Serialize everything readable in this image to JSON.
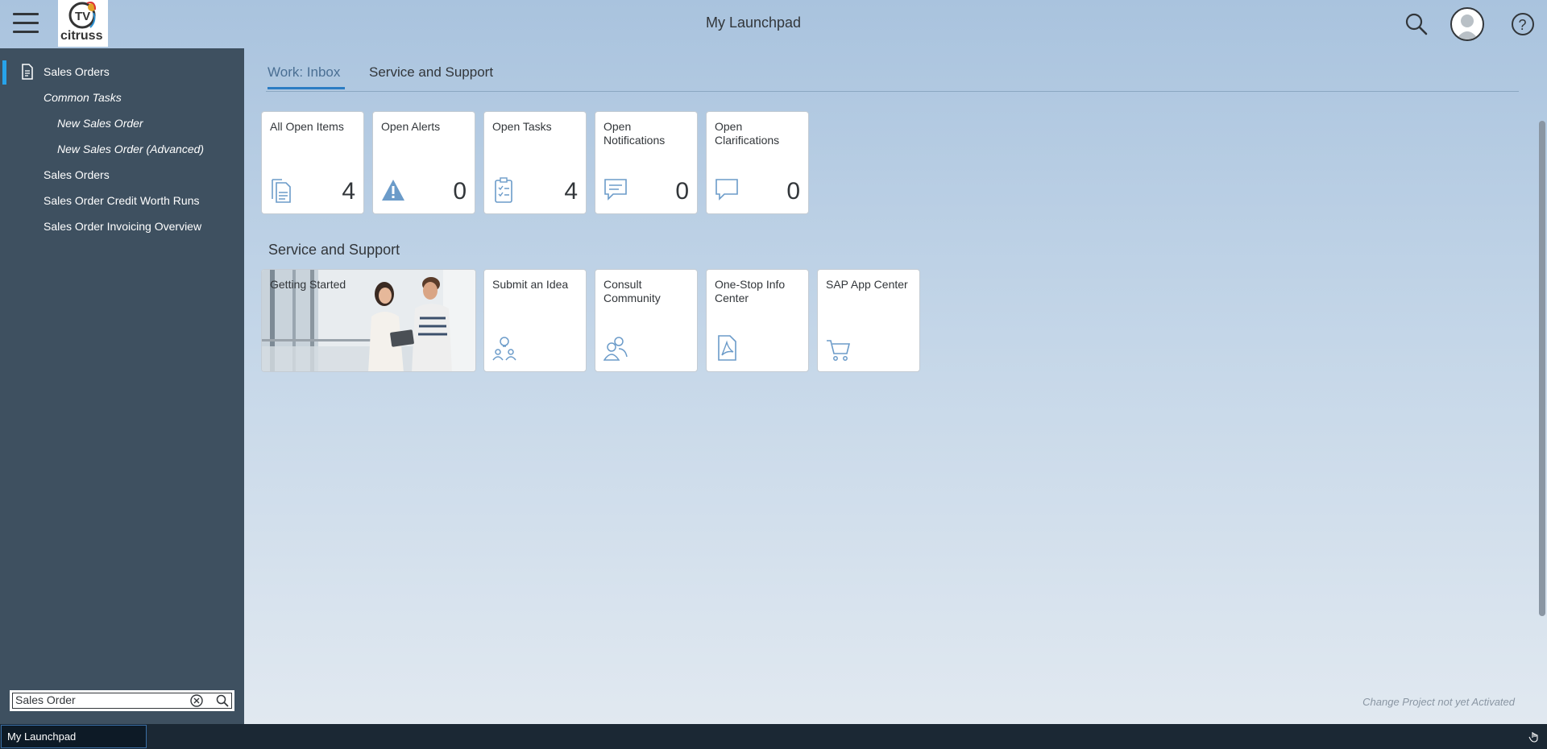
{
  "header": {
    "title": "My Launchpad",
    "logo_text": "citruss",
    "logo_mark": "TV"
  },
  "sidebar": {
    "items": [
      {
        "label": "Sales Orders",
        "icon": "document-icon",
        "active": true
      },
      {
        "label": "Common Tasks"
      },
      {
        "label": "New Sales Order"
      },
      {
        "label": "New Sales Order (Advanced)"
      },
      {
        "label": "Sales Orders"
      },
      {
        "label": "Sales Order Credit Worth Runs"
      },
      {
        "label": "Sales Order Invoicing Overview"
      }
    ],
    "search": {
      "value": "Sales Order",
      "placeholder": ""
    }
  },
  "tabs": [
    {
      "label": "Work: Inbox",
      "selected": true
    },
    {
      "label": "Service and Support",
      "selected": false
    }
  ],
  "work_tiles": [
    {
      "title": "All Open Items",
      "count": "4",
      "icon": "documents-icon"
    },
    {
      "title": "Open Alerts",
      "count": "0",
      "icon": "alert-icon"
    },
    {
      "title": "Open Tasks",
      "count": "4",
      "icon": "task-clipboard-icon"
    },
    {
      "title": "Open Notifications",
      "count": "0",
      "icon": "notification-icon"
    },
    {
      "title": "Open Clarifications",
      "count": "0",
      "icon": "comment-icon"
    }
  ],
  "service_section": {
    "title": "Service and Support",
    "tiles": [
      {
        "title": "Getting Started",
        "icon": "photo"
      },
      {
        "title": "Submit an Idea",
        "icon": "idea-icon"
      },
      {
        "title": "Consult Community",
        "icon": "community-icon"
      },
      {
        "title": "One-Stop Info Center",
        "icon": "pdf-icon"
      },
      {
        "title": "SAP App Center",
        "icon": "cart-icon"
      }
    ]
  },
  "footer_note": "Change Project not yet Activated",
  "taskbar": {
    "active_window": "My Launchpad"
  },
  "colors": {
    "sidebar": "#3e5060",
    "accent": "#27a3ea",
    "tile_icon": "#6b9bc9"
  }
}
